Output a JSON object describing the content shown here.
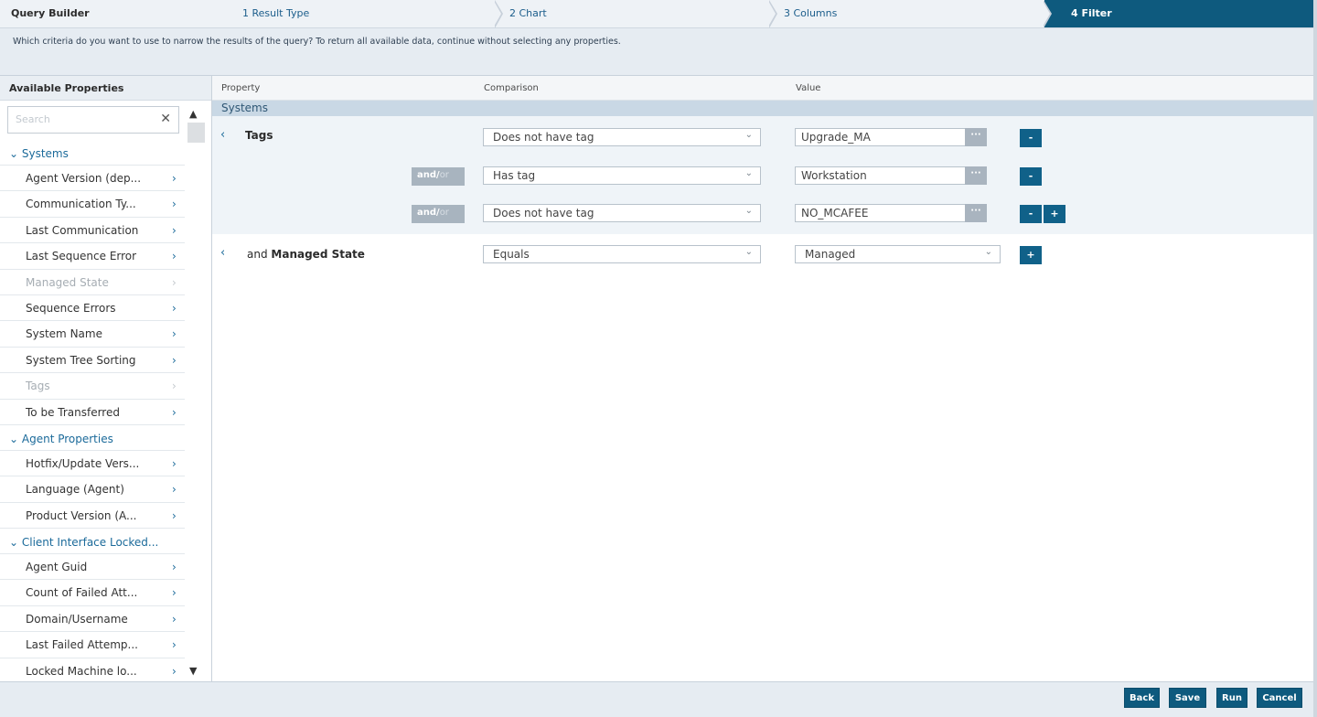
{
  "wizard": {
    "title": "Query Builder",
    "steps": [
      {
        "label": "1 Result Type",
        "active": false
      },
      {
        "label": "2 Chart",
        "active": false
      },
      {
        "label": "3 Columns",
        "active": false
      },
      {
        "label": "4 Filter",
        "active": true
      }
    ]
  },
  "instruction": "Which criteria do you want to use to narrow the results of the query? To return all available data, continue without selecting any properties.",
  "sidebar": {
    "title": "Available Properties",
    "search_placeholder": "Search",
    "groups": [
      {
        "label": "Systems",
        "items": [
          {
            "label": "Agent Version (dep...",
            "disabled": false
          },
          {
            "label": "Communication Ty...",
            "disabled": false
          },
          {
            "label": "Last Communication",
            "disabled": false
          },
          {
            "label": "Last Sequence Error",
            "disabled": false
          },
          {
            "label": "Managed State",
            "disabled": true
          },
          {
            "label": "Sequence Errors",
            "disabled": false
          },
          {
            "label": "System Name",
            "disabled": false
          },
          {
            "label": "System Tree Sorting",
            "disabled": false
          },
          {
            "label": "Tags",
            "disabled": true
          },
          {
            "label": "To be Transferred",
            "disabled": false
          }
        ]
      },
      {
        "label": "Agent Properties",
        "items": [
          {
            "label": "Hotfix/Update Vers...",
            "disabled": false
          },
          {
            "label": "Language (Agent)",
            "disabled": false
          },
          {
            "label": "Product Version (A...",
            "disabled": false
          }
        ]
      },
      {
        "label": "Client Interface Locked...",
        "items": [
          {
            "label": "Agent Guid",
            "disabled": false
          },
          {
            "label": "Count of Failed Att...",
            "disabled": false
          },
          {
            "label": "Domain/Username",
            "disabled": false
          },
          {
            "label": "Last Failed Attemp...",
            "disabled": false
          },
          {
            "label": "Locked Machine lo...",
            "disabled": false
          }
        ]
      }
    ]
  },
  "main": {
    "columns": {
      "property": "Property",
      "comparison": "Comparison",
      "value": "Value"
    },
    "section": "Systems",
    "tags": {
      "property": "Tags",
      "andor_and": "and/",
      "andor_or": "or",
      "rows": [
        {
          "comparison": "Does not have tag",
          "value": "Upgrade_MA"
        },
        {
          "comparison": "Has tag",
          "value": "Workstation"
        },
        {
          "comparison": "Does not have tag",
          "value": "NO_MCAFEE"
        }
      ]
    },
    "managed": {
      "prefix": "and",
      "property": "Managed State",
      "comparison": "Equals",
      "value": "Managed"
    },
    "dots_label": "···",
    "minus_label": "-",
    "plus_label": "+"
  },
  "footer": {
    "back": "Back",
    "save": "Save",
    "run": "Run",
    "cancel": "Cancel"
  },
  "colors": {
    "accent": "#0e5a7e",
    "link": "#1b6a9a",
    "band": "#c9d8e5"
  }
}
